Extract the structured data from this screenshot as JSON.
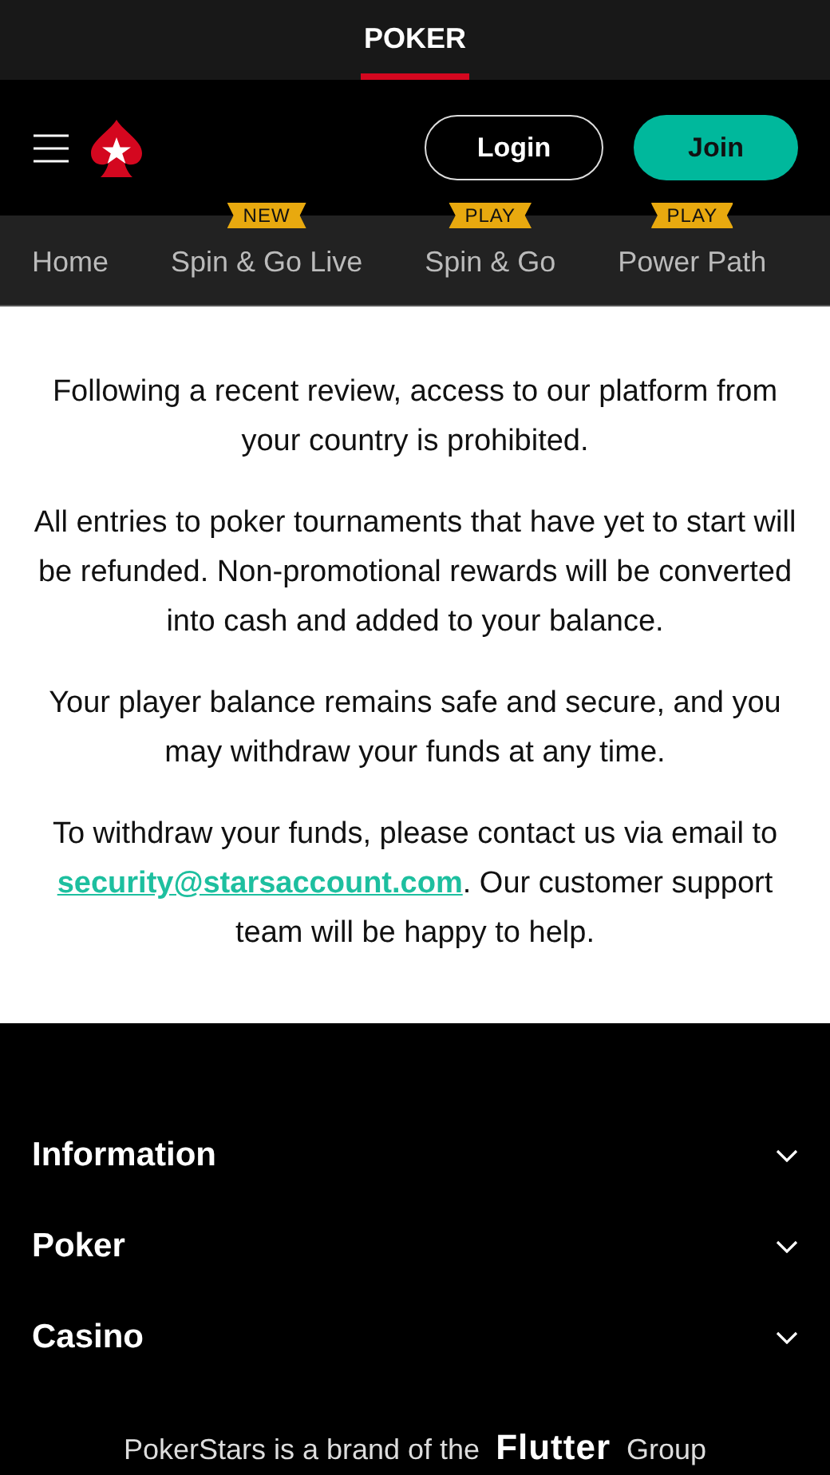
{
  "top_tabs": [
    {
      "label": "POKER",
      "selected": true
    }
  ],
  "header": {
    "login": "Login",
    "join": "Join"
  },
  "nav": [
    {
      "label": "Home"
    },
    {
      "label": "Spin & Go Live",
      "badge": "NEW"
    },
    {
      "label": "Spin & Go",
      "badge": "PLAY"
    },
    {
      "label": "Power Path",
      "badge": "PLAY"
    }
  ],
  "paragraphs": [
    {
      "text": "Following a recent review, access to our platform from your country is prohibited."
    },
    {
      "text": "All entries to poker tournaments that have yet to start will be refunded. Non-promotional rewards will be converted into cash and added to your balance."
    },
    {
      "text": "Your player balance remains safe and secure, and you may withdraw your funds at any time."
    },
    {
      "text": "To withdraw your funds, please contact us via email to ",
      "link": "security@starsaccount.com",
      "after": ". Our customer support team will be happy to help."
    }
  ],
  "footer_sections": [
    {
      "label": "Information",
      "expanded": false
    },
    {
      "label": "Poker",
      "expanded": false
    },
    {
      "label": "Casino",
      "expanded": false
    }
  ],
  "brand_line": {
    "before": "PokerStars is a brand of the",
    "logo": "Flutter",
    "after": "Group"
  }
}
